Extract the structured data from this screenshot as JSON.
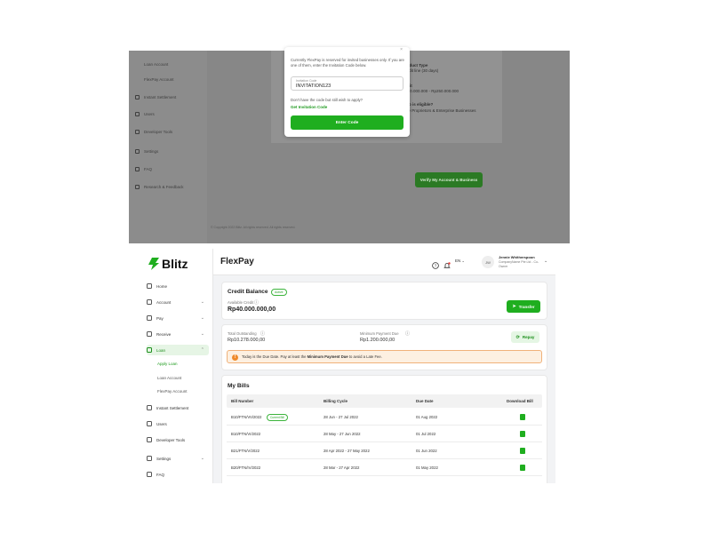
{
  "top_panel": {
    "sidebar": [
      "Loan Account",
      "FlexPay Account",
      "Instant Settlement",
      "Users",
      "Developer Tools",
      "Settings",
      "FAQ",
      "Research & Feedback"
    ],
    "card_lines": [
      "Product Type",
      "Credit line (30 days)",
      "Limit",
      "Rp50.000.000 - Rp250.000.000",
      "Who is eligible?",
      "Sole Proprietors & Enterprise Businesses"
    ],
    "verify_button": "Verify My Account & Business",
    "footer": "© Copyright 2022 Blitz. All rights reserved. All rights reserved.",
    "modal": {
      "intro": "Currently FlexPay is reserved for invited businesses only. If you are one of them, enter the Invitation Code below.",
      "input_label": "Invitation Code",
      "input_value": "INVITATION123",
      "question": "Don't have the code but still wish to apply?",
      "link": "Get Invitation Code",
      "button": "Enter Code",
      "close": "×"
    }
  },
  "app": {
    "brand": "Blitz",
    "page_title": "FlexPay",
    "language": "EN",
    "user": {
      "initials": "JW",
      "name": "Jennie Whitherspoon",
      "role": "CompanyName Pte Ltd - Co-Owner"
    },
    "nav": [
      {
        "label": "Home"
      },
      {
        "label": "Account"
      },
      {
        "label": "Pay"
      },
      {
        "label": "Receive"
      },
      {
        "label": "Loan"
      }
    ],
    "subnav": [
      "Apply Loan",
      "Loan Account",
      "FlexPay Account"
    ],
    "nav_bottom": [
      "Instant Settlement",
      "Users",
      "Developer Tools",
      "Settings",
      "FAQ"
    ],
    "credit": {
      "title": "Credit Balance",
      "badge": "Active",
      "available_label": "Available Credit",
      "available_value": "Rp40.000.000,00",
      "transfer_button": "Transfer"
    },
    "outstanding": {
      "total_label": "Total Outstanding",
      "total_value": "Rp10.278.000,00",
      "min_label": "Minimum Payment Due",
      "min_value": "Rp1.200.000,00",
      "repay_button": "Repay"
    },
    "alert": {
      "icon": "!",
      "pre": "Today is the Due Date. Pay at least the ",
      "bold": "Minimum Payment Due",
      "post": " to avoid a Late Fee."
    },
    "bills": {
      "title": "My Bills",
      "headers": [
        "Bill Number",
        "Billing Cycle",
        "Due Date",
        "Download Bill"
      ],
      "current_badge": "Current Bill",
      "rows": [
        {
          "number": "B10/FTN/VII/2022",
          "cycle": "28 Jun - 27 Jul 2022",
          "due": "01 Aug 2022"
        },
        {
          "number": "B10/FTN/VI/2022",
          "cycle": "28 May - 27 Jun 2022",
          "due": "01 Jul 2022"
        },
        {
          "number": "B21/FTN/V/2022",
          "cycle": "28 Apr 2022 - 27 May 2022",
          "due": "01 Jun 2022"
        },
        {
          "number": "B20/FTN/IV/2022",
          "cycle": "28 Mar - 27 Apr 2022",
          "due": "01 May 2022"
        }
      ]
    }
  }
}
